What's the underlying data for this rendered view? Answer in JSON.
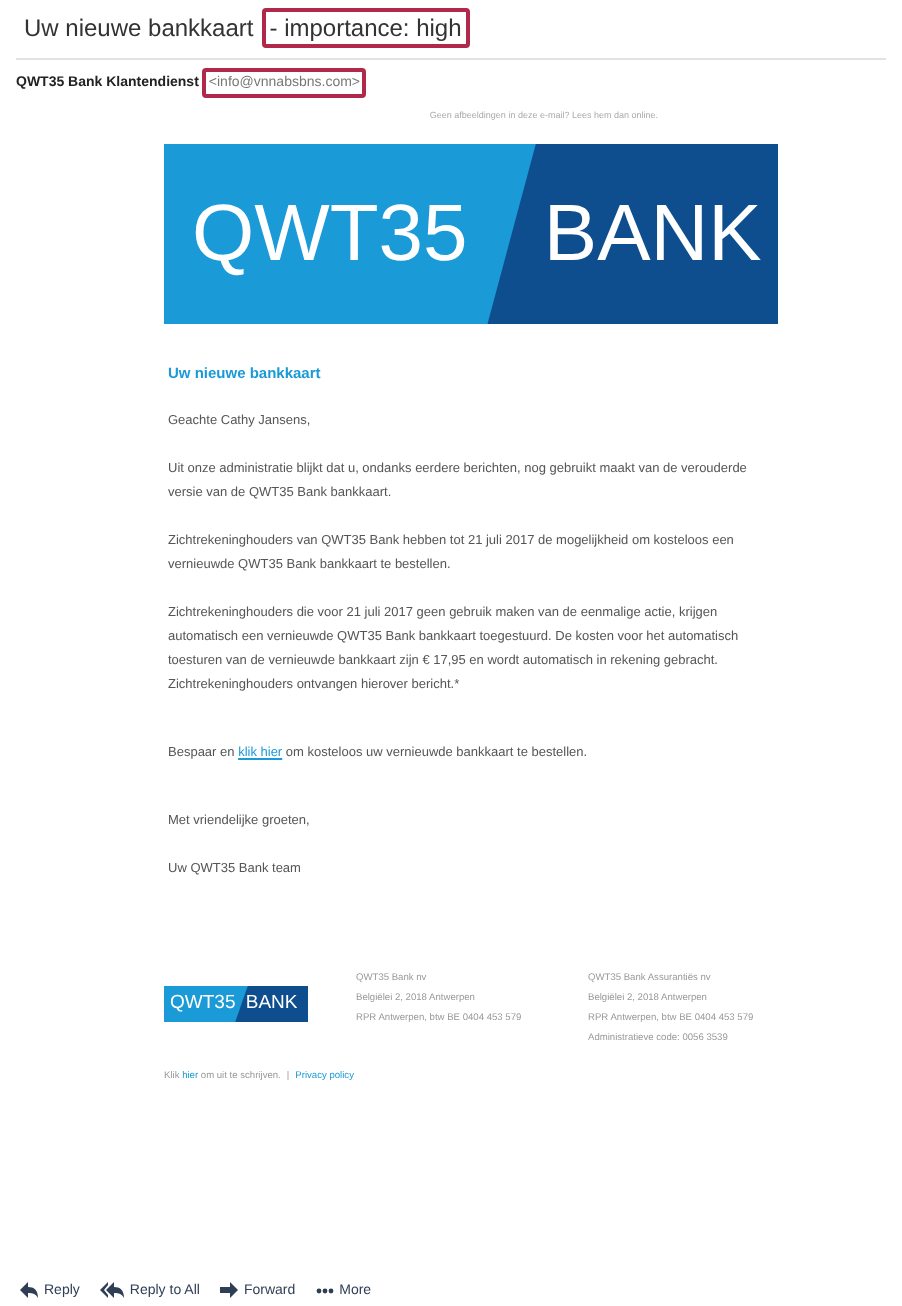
{
  "subject": [
    {
      "text": "Uw nieuwe bankkaart",
      "highlighted": false
    },
    {
      "text": "- importance: high",
      "highlighted": true
    }
  ],
  "sender": {
    "name": "QWT35 Bank Klantendienst",
    "address": "<info@vnnabsbns.com>",
    "address_highlighted": true
  },
  "email": {
    "view_online": "Geen afbeeldingen in deze e-mail? Lees hem dan online.",
    "banner": {
      "left": "QWT35",
      "right": "BANK"
    },
    "heading": "Uw nieuwe bankkaart",
    "greeting": "Geachte Cathy Jansens,",
    "paragraphs": [
      [
        {
          "kind": "text",
          "text": "Uit onze administratie blijkt dat u, ondanks eerdere berichten, nog gebruikt maakt van de verouderde versie van de QWT35 Bank bankkaart."
        }
      ],
      [
        {
          "kind": "text",
          "text": "Zichtrekeninghouders van QWT35 Bank hebben tot 21 juli 2017 de mogelijkheid om kosteloos een vernieuwde QWT35 Bank bankkaart te bestellen."
        }
      ],
      [
        {
          "kind": "text",
          "text": "Zichtrekeninghouders die voor 21 juli 2017 geen gebruik maken van de eenmalige actie, krijgen automatisch een vernieuwde QWT35 Bank bankkaart toegestuurd. De kosten voor het automatisch toesturen van de vernieuwde bankkaart zijn € 17,95 en wordt automatisch in rekening gebracht. Zichtrekeninghouders ontvangen hierover bericht.*"
        }
      ],
      [
        {
          "kind": "text",
          "text": "Bespaar en "
        },
        {
          "kind": "link",
          "text": "klik hier"
        },
        {
          "kind": "text",
          "text": " om kosteloos uw vernieuwde bankkaart te bestellen."
        }
      ]
    ],
    "closing": "Met vriendelijke groeten,",
    "signature": "Uw QWT35 Bank team",
    "footer": {
      "logo": {
        "left": "QWT35",
        "right": "BANK"
      },
      "addresses": [
        [
          "QWT35 Bank nv",
          "Belgiëlei 2, 2018 Antwerpen",
          "RPR Antwerpen, btw BE 0404 453 579"
        ],
        [
          "QWT35 Bank Assurantiës nv",
          "Belgiëlei 2, 2018 Antwerpen",
          "RPR Antwerpen, btw BE 0404 453 579",
          "Administratieve code: 0056 3539"
        ]
      ],
      "unsubscribe": [
        {
          "kind": "text",
          "text": "Klik "
        },
        {
          "kind": "link",
          "text": "hier"
        },
        {
          "kind": "text",
          "text": " om uit te schrijven."
        }
      ],
      "separator": "|",
      "privacy": "Privacy policy"
    }
  },
  "actions": [
    {
      "label": "Reply",
      "kind": "reply"
    },
    {
      "label": "Reply to All",
      "kind": "replyall"
    },
    {
      "label": "Forward",
      "kind": "forward"
    },
    {
      "label": "More",
      "kind": "more"
    }
  ]
}
